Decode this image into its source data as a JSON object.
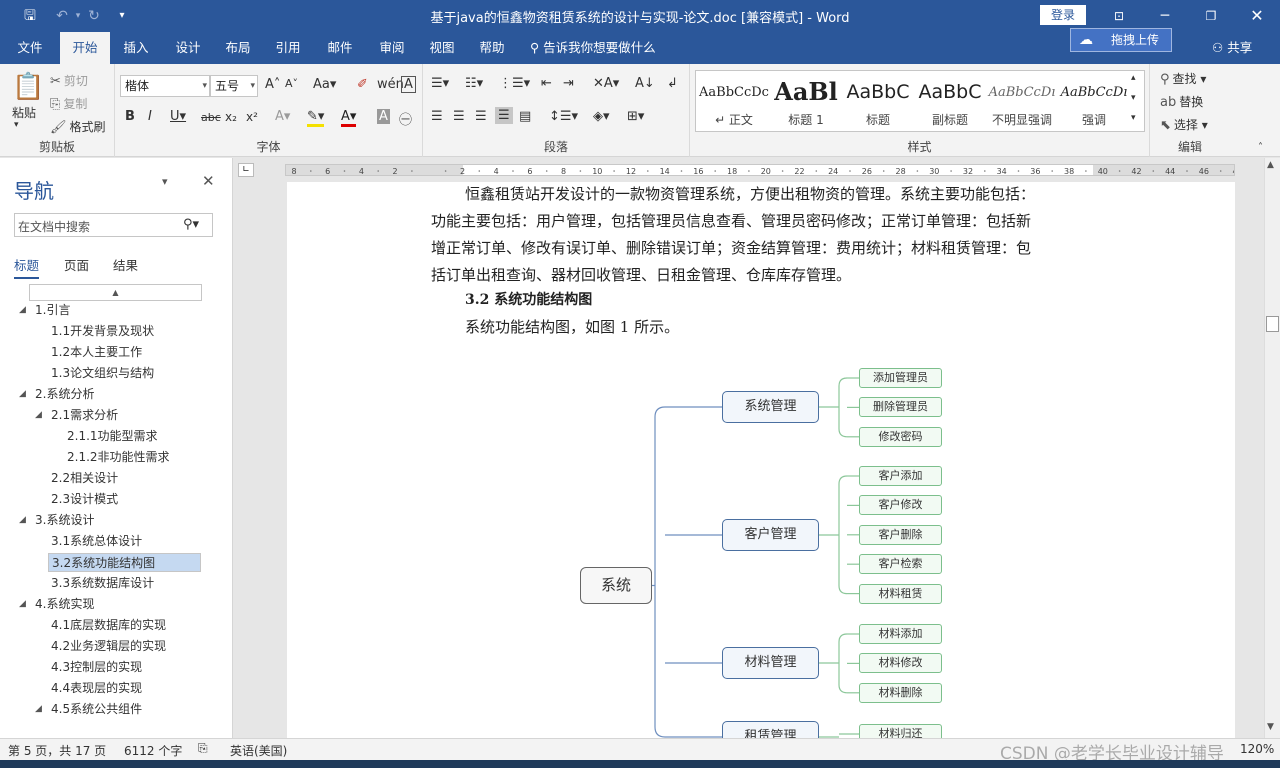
{
  "window": {
    "title": "基于java的恒鑫物资租赁系统的设计与实现-论文.doc [兼容模式]  -  Word",
    "login_label": "登录"
  },
  "tabs": [
    "文件",
    "开始",
    "插入",
    "设计",
    "布局",
    "引用",
    "邮件",
    "审阅",
    "视图",
    "帮助"
  ],
  "active_tab": "开始",
  "tellme": "告诉我你想要做什么",
  "upload_label": "拖拽上传",
  "share_label": "共享",
  "ribbon": {
    "clipboard": {
      "paste": "粘贴",
      "cut": "剪切",
      "copy": "复制",
      "format_painter": "格式刷",
      "label": "剪贴板"
    },
    "font": {
      "name": "楷体",
      "size": "五号",
      "label": "字体"
    },
    "paragraph": {
      "label": "段落"
    },
    "styles": {
      "label": "样式",
      "items": [
        {
          "preview": "AaBbCcDc",
          "name": "↵ 正文"
        },
        {
          "preview": "AaBl",
          "name": "标题 1"
        },
        {
          "preview": "AaBbC",
          "name": "标题"
        },
        {
          "preview": "AaBbC",
          "name": "副标题"
        },
        {
          "preview": "AaBbCcDı",
          "name": "不明显强调"
        },
        {
          "preview": "AaBbCcDı",
          "name": "强调"
        }
      ]
    },
    "editing": {
      "find": "查找",
      "replace": "替换",
      "select": "选择",
      "label": "编辑"
    }
  },
  "nav": {
    "title": "导航",
    "search_placeholder": "在文档中搜索",
    "tabs": [
      "标题",
      "页面",
      "结果"
    ],
    "items": [
      {
        "text": "1.引言",
        "level": 1,
        "expanded": true
      },
      {
        "text": "1.1开发背景及现状",
        "level": 2
      },
      {
        "text": "1.2本人主要工作",
        "level": 2
      },
      {
        "text": "1.3论文组织与结构",
        "level": 2
      },
      {
        "text": "2.系统分析",
        "level": 1,
        "expanded": true
      },
      {
        "text": "2.1需求分析",
        "level": 2,
        "expanded": true
      },
      {
        "text": "2.1.1功能型需求",
        "level": 3
      },
      {
        "text": "2.1.2非功能性需求",
        "level": 3
      },
      {
        "text": "2.2相关设计",
        "level": 2
      },
      {
        "text": "2.3设计模式",
        "level": 2
      },
      {
        "text": "3.系统设计",
        "level": 1,
        "expanded": true
      },
      {
        "text": "3.1系统总体设计",
        "level": 2
      },
      {
        "text": "3.2系统功能结构图",
        "level": 2,
        "selected": true
      },
      {
        "text": "3.3系统数据库设计",
        "level": 2
      },
      {
        "text": "4.系统实现",
        "level": 1,
        "expanded": true
      },
      {
        "text": "4.1底层数据库的实现",
        "level": 2
      },
      {
        "text": "4.2业务逻辑层的实现",
        "level": 2
      },
      {
        "text": "4.3控制层的实现",
        "level": 2
      },
      {
        "text": "4.4表现层的实现",
        "level": 2
      },
      {
        "text": "4.5系统公共组件",
        "level": 2,
        "expanded": true
      }
    ]
  },
  "doc": {
    "para1": [
      "恒鑫租赁站开发设计的一款物资管理系统，方便出租物资的管理。系统主要功能包括：",
      "功能主要包括：用户管理，包括管理员信息查看、管理员密码修改；正常订单管理：包括新",
      "增正常订单、修改有误订单、删除错误订单；资金结算管理：费用统计；材料租赁管理：包",
      "括订单出租查询、器材回收管理、日租金管理、仓库库存管理。"
    ],
    "heading": "3.2 系统功能结构图",
    "para2": "系统功能结构图，如图 1 所示。",
    "diagram": {
      "root": "系统",
      "groups": [
        {
          "name": "系统管理",
          "leaves": [
            "添加管理员",
            "删除管理员",
            "修改密码"
          ]
        },
        {
          "name": "客户管理",
          "leaves": [
            "客户添加",
            "客户修改",
            "客户删除",
            "客户检索",
            "材料租赁"
          ]
        },
        {
          "name": "材料管理",
          "leaves": [
            "材料添加",
            "材料修改",
            "材料删除"
          ]
        },
        {
          "name": "租赁管理",
          "leaves": [
            "材料归还"
          ]
        }
      ]
    }
  },
  "status": {
    "page": "第 5 页，共 17 页",
    "words": "6112 个字",
    "lang": "英语(美国)",
    "watermark": "CSDN @老学长毕业设计辅导",
    "zoom": "120%"
  }
}
